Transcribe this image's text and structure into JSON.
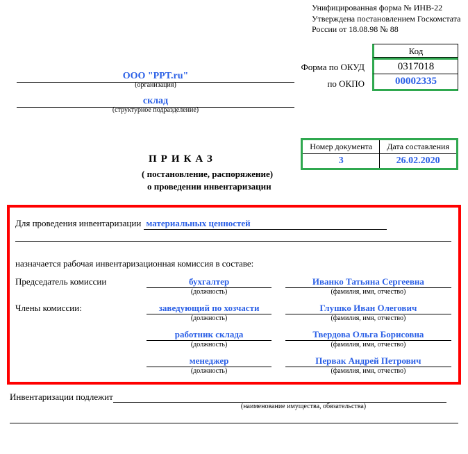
{
  "top_note": {
    "line1": "Унифицированная форма № ИНВ-22",
    "line2": "Утверждена постановлением Госкомстата",
    "line3": "России от 18.08.98 № 88"
  },
  "codes": {
    "kod_label": "Код",
    "okud_label": "Форма по ОКУД",
    "okud_value": "0317018",
    "okpo_label": "по ОКПО",
    "okpo_value": "00002335"
  },
  "org": {
    "value": "ООО \"PPT.ru\"",
    "caption": "(организация)"
  },
  "dept": {
    "value": "склад",
    "caption": "(структурное подразделение)"
  },
  "doc": {
    "num_header": "Номер документа",
    "date_header": "Дата составления",
    "num_value": "3",
    "date_value": "26.02.2020",
    "title": "ПРИКАЗ",
    "subtitle1": "( постановление, распоряжение)",
    "subtitle2": "о проведении инвентаризации"
  },
  "body": {
    "intro_label": "Для проведения инвентаризации",
    "intro_value": "материальных ценностей",
    "commission_text": "назначается рабочая инвентаризационная комиссия в составе:",
    "chairman_label": "Председатель комиссии",
    "members_label": "Члены комиссии:",
    "pos_caption": "(должность)",
    "name_caption": "(фамилия, имя, отчество)",
    "rows": [
      {
        "pos": "бухгалтер",
        "name": "Иванко Татьяна Сергеевна"
      },
      {
        "pos": "заведующий по хозчасти",
        "name": "Глушко Иван Олегович"
      },
      {
        "pos": "работник склада",
        "name": "Твердова Ольга Борисовна"
      },
      {
        "pos": "менеджер",
        "name": "Первак Андрей Петрович"
      }
    ]
  },
  "subject": {
    "label": "Инвентаризации подлежит",
    "caption": "(наименование имущества, обязательства)"
  }
}
